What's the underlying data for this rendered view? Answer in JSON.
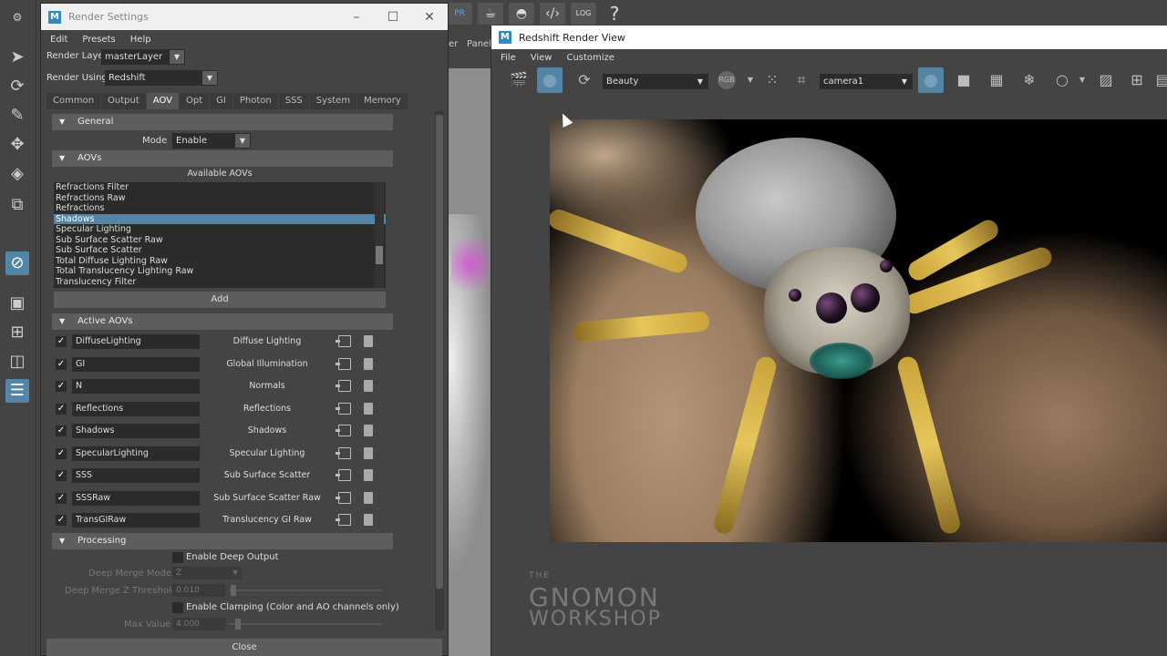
{
  "render_settings": {
    "title": "Render Settings",
    "menu": [
      "Edit",
      "Presets",
      "Help"
    ],
    "render_layer_label": "Render Layer",
    "render_layer_value": "masterLayer",
    "render_using_label": "Render Using",
    "render_using_value": "Redshift",
    "tabs": [
      "Common",
      "Output",
      "AOV",
      "Opt",
      "GI",
      "Photon",
      "SSS",
      "System",
      "Memory"
    ],
    "active_tab": "AOV",
    "general": {
      "header": "General",
      "mode_label": "Mode",
      "mode_value": "Enable"
    },
    "aovs": {
      "header": "AOVs",
      "available_label": "Available AOVs",
      "items": [
        "Refractions Filter",
        "Refractions Raw",
        "Refractions",
        "Shadows",
        "Specular Lighting",
        "Sub Surface Scatter Raw",
        "Sub Surface Scatter",
        "Total Diffuse Lighting Raw",
        "Total Translucency Lighting Raw",
        "Translucency Filter"
      ],
      "selected": "Shadows",
      "add_label": "Add"
    },
    "active_aovs": {
      "header": "Active AOVs",
      "rows": [
        {
          "name": "DiffuseLighting",
          "desc": "Diffuse Lighting"
        },
        {
          "name": "GI",
          "desc": "Global Illumination"
        },
        {
          "name": "N",
          "desc": "Normals"
        },
        {
          "name": "Reflections",
          "desc": "Reflections"
        },
        {
          "name": "Shadows",
          "desc": "Shadows"
        },
        {
          "name": "SpecularLighting",
          "desc": "Specular Lighting"
        },
        {
          "name": "SSS",
          "desc": "Sub Surface Scatter"
        },
        {
          "name": "SSSRaw",
          "desc": "Sub Surface Scatter Raw"
        },
        {
          "name": "TransGIRaw",
          "desc": "Translucency GI Raw"
        }
      ]
    },
    "processing": {
      "header": "Processing",
      "deep_output_label": "Enable Deep Output",
      "deep_merge_mode_label": "Deep Merge Mode",
      "deep_merge_mode_value": "Z",
      "deep_merge_z_label": "Deep Merge Z Threshold",
      "deep_merge_z_value": "0.010",
      "clamping_label": "Enable Clamping (Color and AO channels only)",
      "max_value_label": "Max Value",
      "max_value_value": "4.000"
    },
    "close_label": "Close"
  },
  "render_view": {
    "title": "Redshift Render View",
    "menu": [
      "File",
      "View",
      "Customize"
    ],
    "aov_select": "Beauty",
    "camera_select": "camera1",
    "rgb_label": "RGB"
  },
  "maya": {
    "viewport_menu": "Panel",
    "viewport_menu_2": "er",
    "shelf_pr": "PR",
    "shelf_log": "LOG"
  },
  "watermark": {
    "line1": "GNOMON",
    "line2": "WORKSHOP",
    "prefix": "THE"
  },
  "colors": {
    "accent": "#5285a6",
    "panel": "#444444",
    "field": "#2b2b2b"
  }
}
